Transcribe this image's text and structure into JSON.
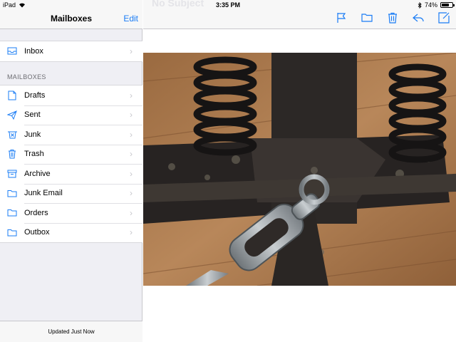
{
  "status": {
    "device": "iPad",
    "time": "3:35 PM",
    "battery": "74%",
    "battery_level": 0.74
  },
  "sidebar": {
    "title": "Mailboxes",
    "edit_label": "Edit",
    "inbox": {
      "label": "Inbox",
      "icon": "inbox-icon"
    },
    "section_label": "MAILBOXES",
    "items": [
      {
        "label": "Drafts",
        "icon": "draft-document-icon"
      },
      {
        "label": "Sent",
        "icon": "paper-plane-icon"
      },
      {
        "label": "Junk",
        "icon": "junk-tray-icon"
      },
      {
        "label": "Trash",
        "icon": "trash-icon"
      },
      {
        "label": "Archive",
        "icon": "archive-box-icon"
      },
      {
        "label": "Junk Email",
        "icon": "folder-icon"
      },
      {
        "label": "Orders",
        "icon": "folder-icon"
      },
      {
        "label": "Outbox",
        "icon": "folder-icon"
      }
    ],
    "footer": "Updated Just Now"
  },
  "message": {
    "subject": "No Subject"
  },
  "colors": {
    "accent": "#1a7cf5",
    "sidebar_bg": "#efeff4",
    "bar_bg": "#f7f7f7"
  }
}
